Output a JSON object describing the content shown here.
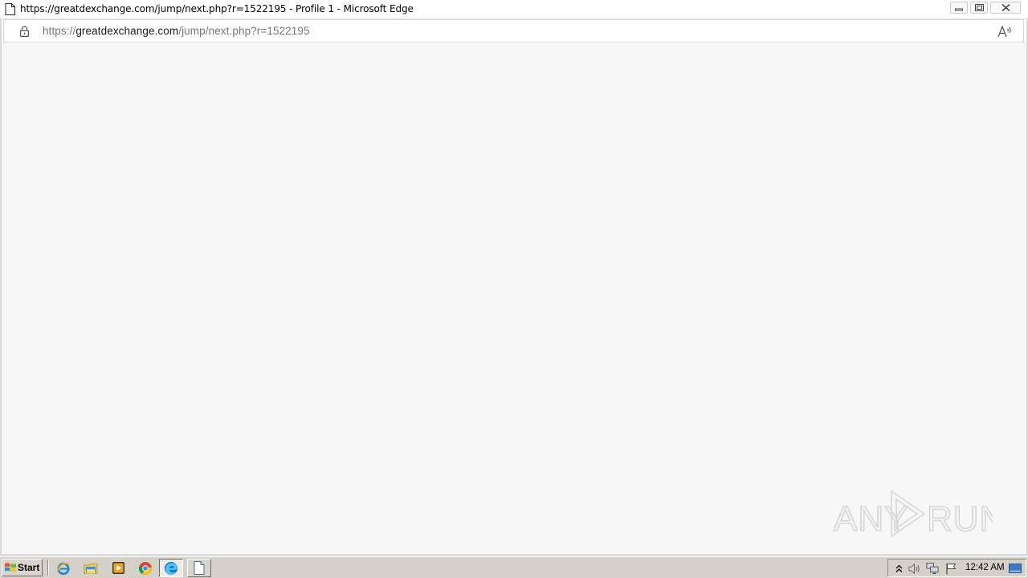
{
  "window": {
    "title": "https://greatdexchange.com/jump/next.php?r=1522195 - Profile 1 - Microsoft Edge",
    "controls": [
      "minimize-icon",
      "restore-icon",
      "close-icon"
    ]
  },
  "address_bar": {
    "scheme": "https://",
    "host": "greatdexchange.com",
    "path": "/jump/next.php?r=1522195",
    "lock_icon": "lock-icon",
    "read_aloud_icon": "read-aloud-icon"
  },
  "watermark": {
    "text_left": "ANY",
    "text_right": "RUN"
  },
  "taskbar": {
    "start_label": "Start",
    "quick_launch": [
      "internet-explorer-icon",
      "file-explorer-icon",
      "media-player-icon",
      "chrome-icon"
    ],
    "tasks": [
      "edge-icon",
      "document-icon"
    ],
    "tray_icons": [
      "show-hidden-icons-icon",
      "volume-icon",
      "network-icon",
      "action-center-flag-icon"
    ],
    "clock": "12:42 AM"
  },
  "colors": {
    "content_bg": "#f7f7f7",
    "taskbar_bg": "#d5d0c8",
    "url_dim": "#777777",
    "watermark": "#dcdcdc"
  }
}
